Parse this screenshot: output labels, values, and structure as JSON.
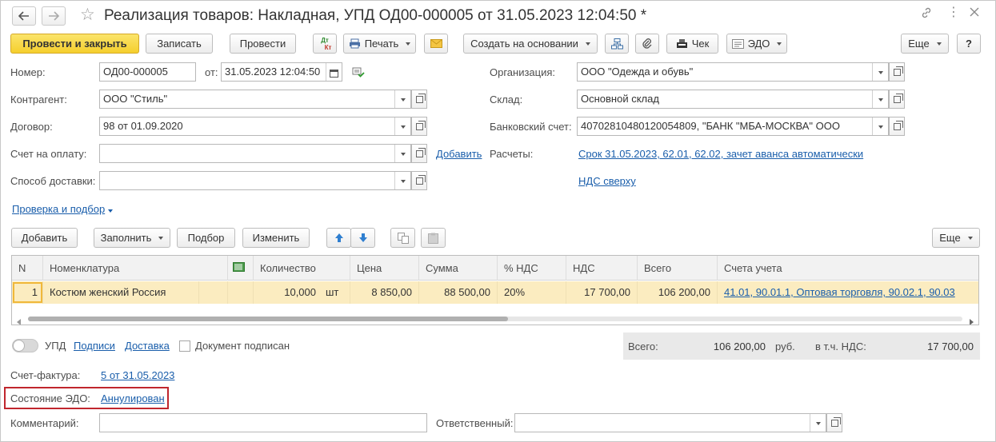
{
  "window": {
    "title": "Реализация товаров: Накладная, УПД ОД00-000005 от 31.05.2023 12:04:50 *",
    "back_icon": "arrow-left-icon",
    "forward_icon": "arrow-right-icon",
    "favorite_icon": "star-icon",
    "link_icon": "link-icon",
    "menu_icon": "more-vertical-icon",
    "close_icon": "close-icon"
  },
  "toolbar": {
    "post_close": "Провести и закрыть",
    "save": "Записать",
    "post": "Провести",
    "dtkt_top": "Дт",
    "dtkt_bottom": "Кт",
    "print": "Печать",
    "create_based": "Создать на основании",
    "receipt": "Чек",
    "edo": "ЭДО",
    "more": "Еще",
    "help": "?"
  },
  "header": {
    "number_label": "Номер:",
    "number_value": "ОД00-000005",
    "date_label": "от:",
    "date_value": "31.05.2023 12:04:50",
    "counterparty_label": "Контрагент:",
    "counterparty_value": "ООО \"Стиль\"",
    "contract_label": "Договор:",
    "contract_value": "98 от 01.09.2020",
    "invoice_label": "Счет на оплату:",
    "invoice_value": "",
    "add_link": "Добавить",
    "delivery_label": "Способ доставки:",
    "delivery_value": "",
    "org_label": "Организация:",
    "org_value": "ООО \"Одежда и обувь\"",
    "warehouse_label": "Склад:",
    "warehouse_value": "Основной склад",
    "bank_label": "Банковский счет:",
    "bank_value": "40702810480120054809, \"БАНК \"МБА-МОСКВА\" ООО",
    "settlements_label": "Расчеты:",
    "settlements_link": "Срок 31.05.2023, 62.01, 62.02, зачет аванса автоматически",
    "vat_link": "НДС сверху",
    "check_link": "Проверка и подбор"
  },
  "table_toolbar": {
    "add": "Добавить",
    "fill": "Заполнить",
    "selection": "Подбор",
    "change": "Изменить",
    "more": "Еще"
  },
  "table": {
    "headers": {
      "n": "N",
      "item": "Номенклатура",
      "qty": "Количество",
      "price": "Цена",
      "sum": "Сумма",
      "vat_rate": "% НДС",
      "vat": "НДС",
      "total": "Всего",
      "accounts": "Счета учета"
    },
    "rows": [
      {
        "n": "1",
        "item": "Костюм женский Россия",
        "qty": "10,000",
        "unit": "шт",
        "price": "8 850,00",
        "sum": "88 500,00",
        "vat_rate": "20%",
        "vat": "17 700,00",
        "total": "106 200,00",
        "accounts": "41.01, 90.01.1, Оптовая торговля, 90.02.1, 90.03"
      }
    ]
  },
  "footer": {
    "upd_label": "УПД",
    "signatures_link": "Подписи",
    "delivery_link": "Доставка",
    "signed_label": "Документ подписан",
    "total_label": "Всего:",
    "total_value": "106 200,00",
    "currency": "руб.",
    "vat_label": "в т.ч. НДС:",
    "vat_value": "17 700,00",
    "invoice_label": "Счет-фактура:",
    "invoice_link": "5 от 31.05.2023",
    "edo_state_label": "Состояние ЭДО:",
    "edo_state_link": "Аннулирован",
    "comment_label": "Комментарий:",
    "comment_value": "",
    "responsible_label": "Ответственный:",
    "responsible_value": ""
  }
}
